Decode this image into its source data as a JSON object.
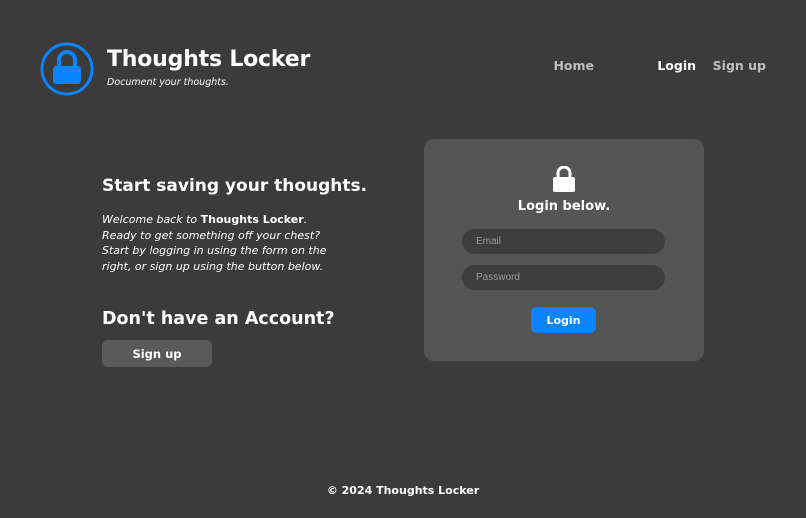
{
  "brand": {
    "title": "Thoughts Locker",
    "tagline": "Document your thoughts.",
    "logo_icon": "lock-icon",
    "accent_color": "#0a84ff"
  },
  "nav": {
    "items": [
      {
        "label": "Home",
        "active": false
      },
      {
        "label": "Login",
        "active": true
      },
      {
        "label": "Sign up",
        "active": false
      }
    ]
  },
  "intro": {
    "heading": "Start saving your thoughts.",
    "text_prefix": "Welcome back to ",
    "text_bold": "Thoughts Locker",
    "text_suffix": ". Ready to get something off your chest? Start by logging in using the form on the right, or sign up using the button below."
  },
  "signup_section": {
    "heading": "Don't have an Account?",
    "button_label": "Sign up"
  },
  "login_card": {
    "icon": "lock-icon",
    "title": "Login below.",
    "email_placeholder": "Email",
    "email_value": "",
    "password_placeholder": "Password",
    "password_value": "",
    "button_label": "Login"
  },
  "footer": {
    "text": "© 2024 Thoughts Locker"
  }
}
